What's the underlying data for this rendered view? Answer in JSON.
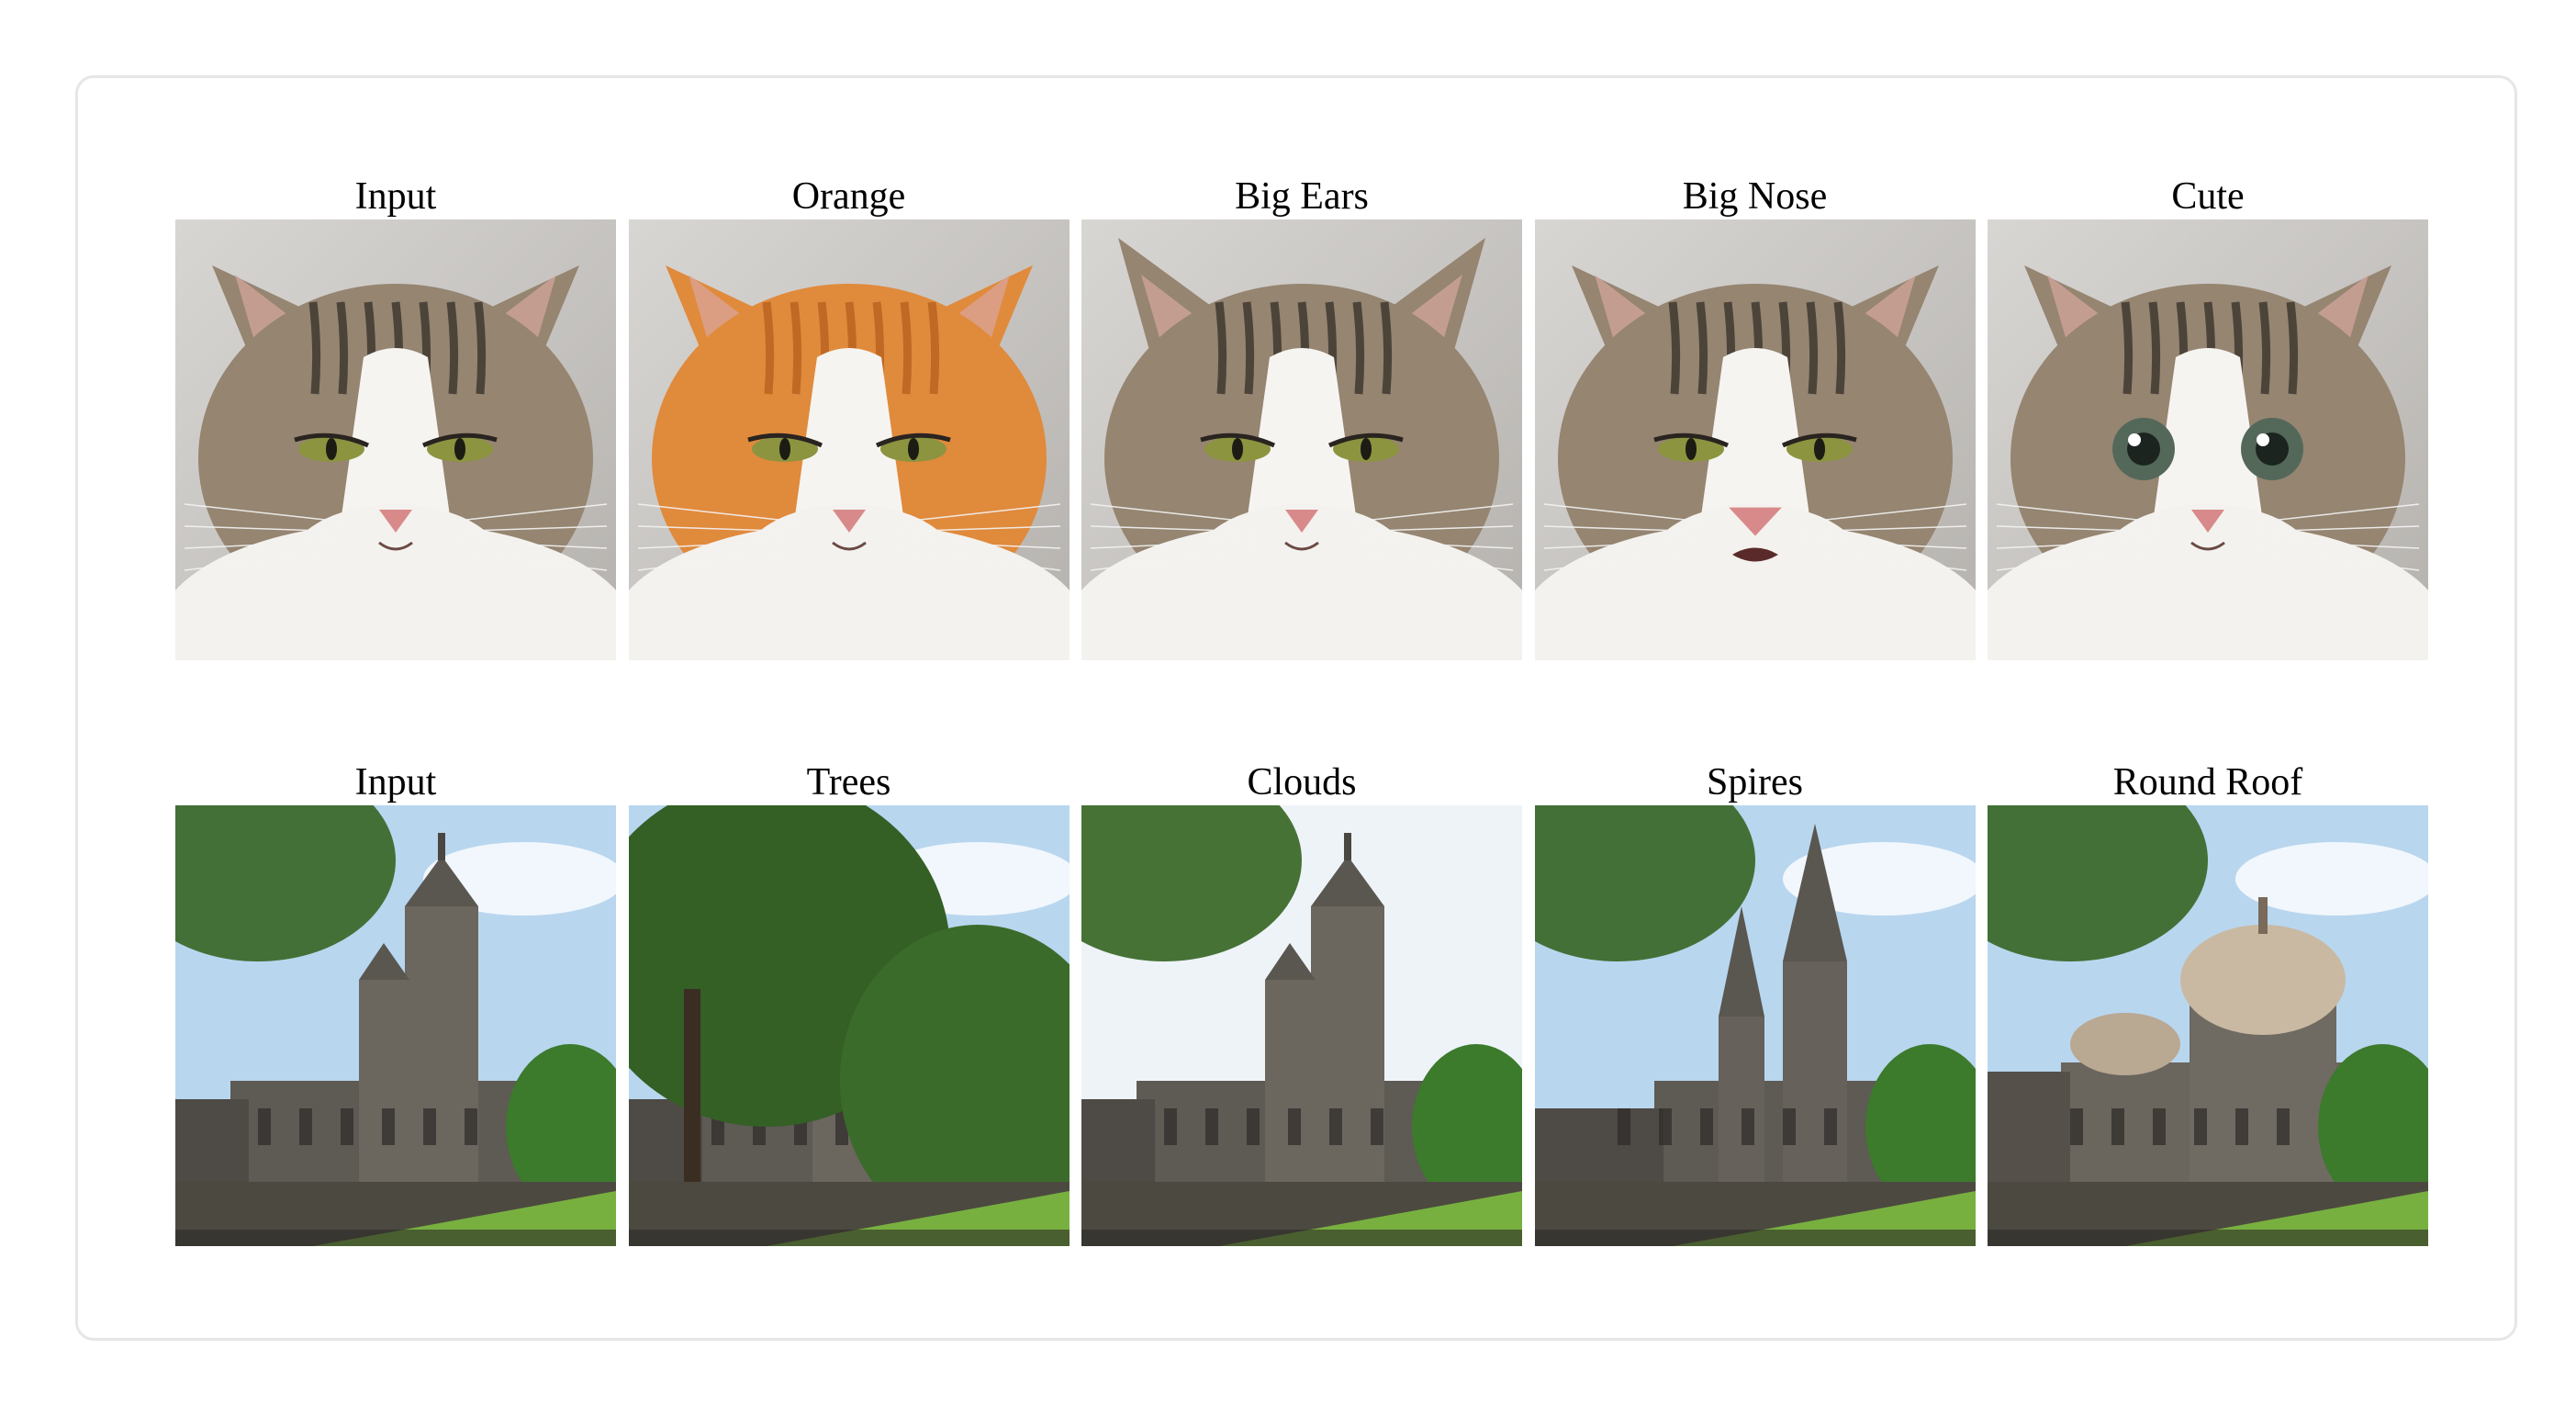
{
  "rows": [
    {
      "name": "cat-row",
      "cells": [
        {
          "label": "Input",
          "variant": "tabby",
          "eyes": "squint",
          "coat": "#8f7f6c"
        },
        {
          "label": "Orange",
          "variant": "orange",
          "eyes": "squint",
          "coat": "#d9782f"
        },
        {
          "label": "Big Ears",
          "variant": "tabby-bigears",
          "eyes": "squint",
          "coat": "#8f7f6c"
        },
        {
          "label": "Big Nose",
          "variant": "tabby-bignose",
          "eyes": "squint",
          "coat": "#8f7f6c"
        },
        {
          "label": "Cute",
          "variant": "tabby-cute",
          "eyes": "round",
          "coat": "#8f7f6c"
        }
      ]
    },
    {
      "name": "church-row",
      "cells": [
        {
          "label": "Input",
          "variant": "church"
        },
        {
          "label": "Trees",
          "variant": "church-trees"
        },
        {
          "label": "Clouds",
          "variant": "church-clouds"
        },
        {
          "label": "Spires",
          "variant": "church-spires"
        },
        {
          "label": "Round Roof",
          "variant": "church-dome"
        }
      ]
    }
  ],
  "colors": {
    "frame_border": "#e6e6e6",
    "sky": "#cfe3f5",
    "grass": "#6fa63a",
    "stone": "#6f6a62",
    "foliage": "#2f5a22"
  }
}
